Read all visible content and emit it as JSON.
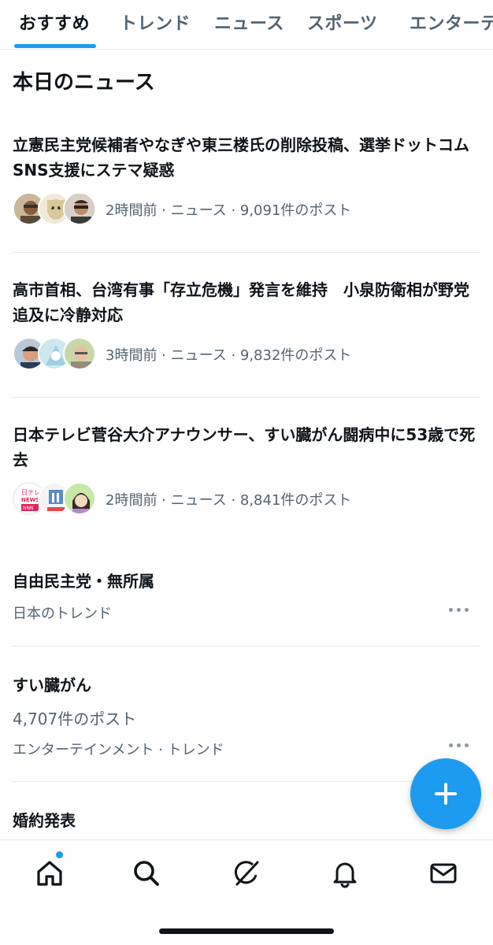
{
  "tabs": [
    {
      "label": "おすすめ",
      "active": true
    },
    {
      "label": "トレンド",
      "active": false
    },
    {
      "label": "ニュース",
      "active": false
    },
    {
      "label": "スポーツ",
      "active": false
    },
    {
      "label": "エンターテ",
      "active": false
    }
  ],
  "section_title": "本日のニュース",
  "news": [
    {
      "headline": "立憲民主党候補者やなぎや東三楼氏の削除投稿、選挙ドットコムSNS支援にステマ疑惑",
      "meta": "2時間前 · ニュース · 9,091件のポスト"
    },
    {
      "headline": "高市首相、台湾有事「存立危機」発言を維持　小泉防衛相が野党追及に冷静対応",
      "meta": "3時間前 · ニュース · 9,832件のポスト"
    },
    {
      "headline": "日本テレビ菅谷大介アナウンサー、すい臓がん闘病中に53歳で死去",
      "meta": "2時間前 · ニュース · 8,841件のポスト"
    }
  ],
  "trends": [
    {
      "title": "自由民主党・無所属",
      "count": "",
      "category": "日本のトレンド"
    },
    {
      "title": "すい臓がん",
      "count": "4,707件のポスト",
      "category": "エンターテインメント · トレンド"
    },
    {
      "title": "婚約発表",
      "count": "",
      "category": ""
    }
  ],
  "avatar_badges": {
    "ntv_line1": "日テレ",
    "ntv_line2": "NEWS",
    "ntv_line3": "NNN"
  },
  "icons": {
    "compose": "plus-icon",
    "nav": [
      "home-icon",
      "search-icon",
      "grok-icon",
      "bell-icon",
      "mail-icon"
    ]
  },
  "colors": {
    "accent": "#1d9bf0",
    "text_primary": "#0f1419",
    "text_secondary": "#536471",
    "divider": "#e6e9ec"
  }
}
